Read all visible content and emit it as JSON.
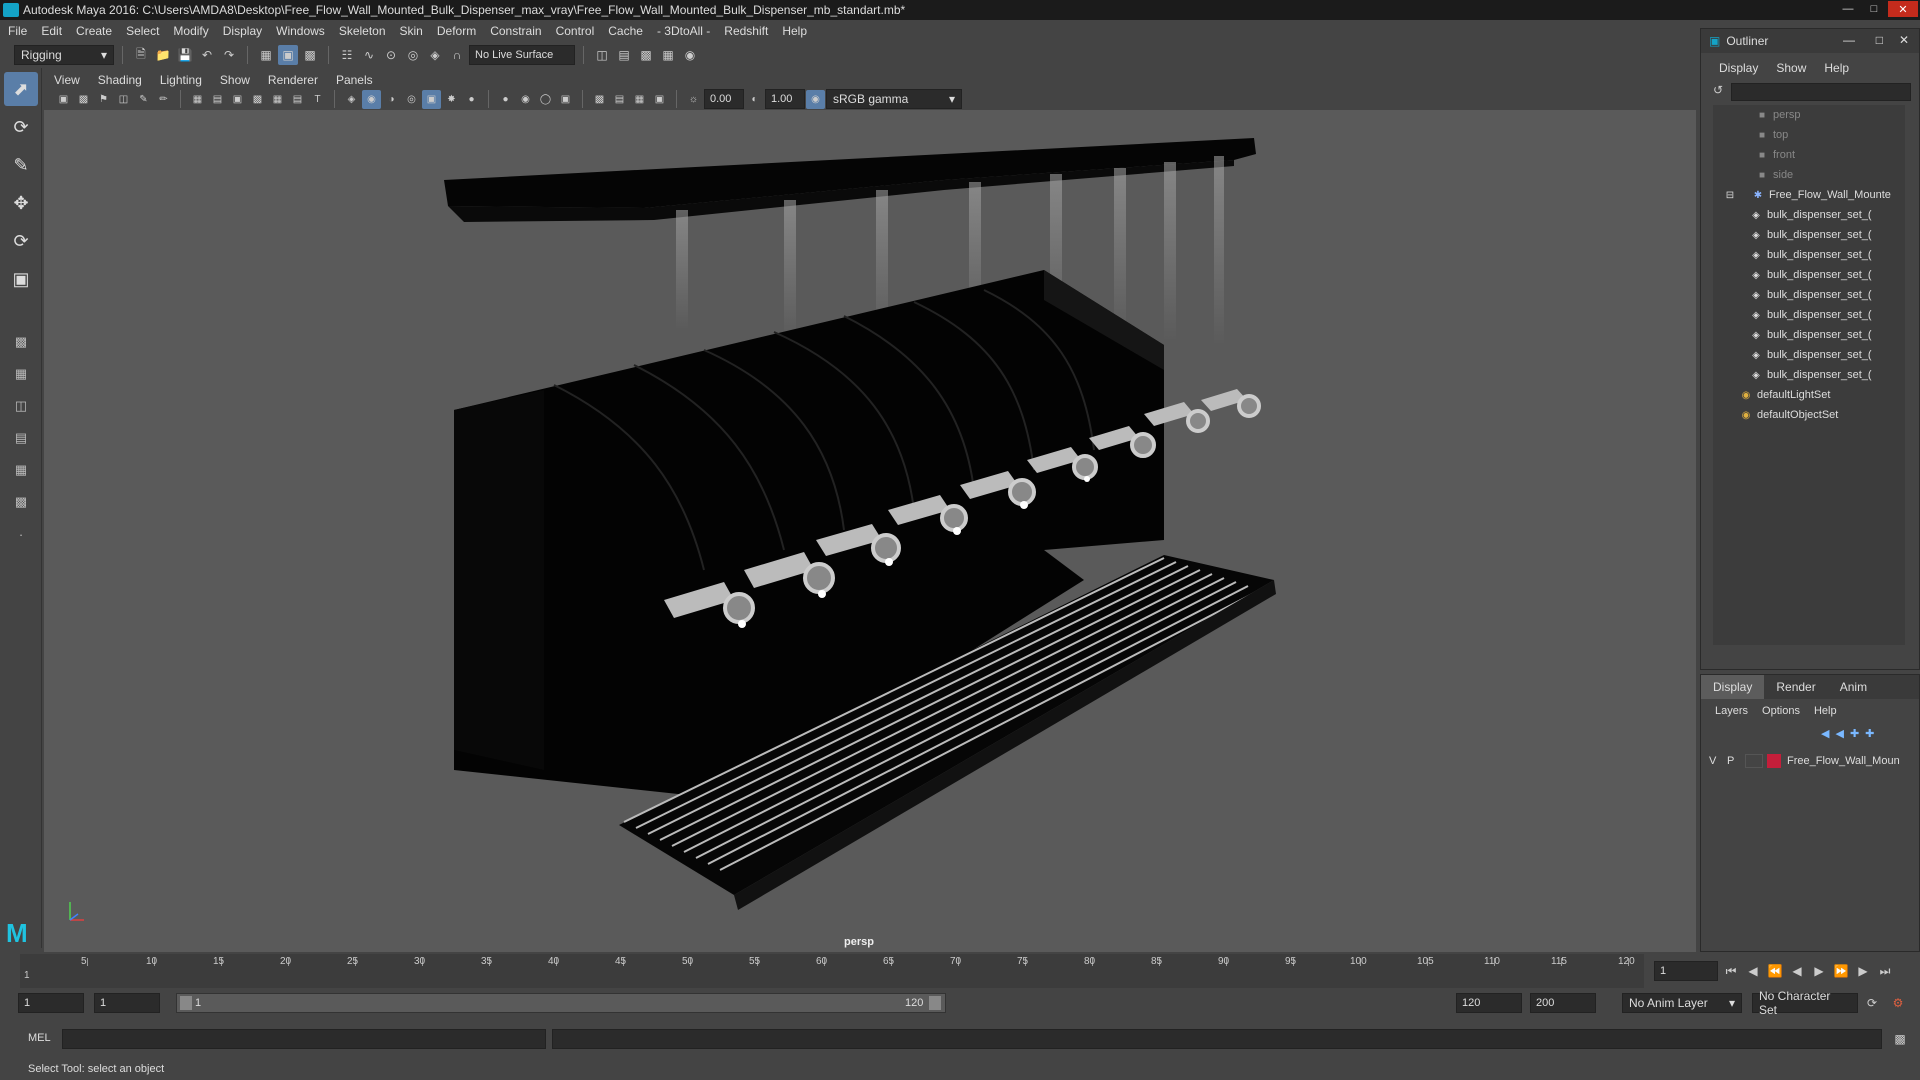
{
  "window": {
    "title": "Autodesk Maya 2016: C:\\Users\\AMDA8\\Desktop\\Free_Flow_Wall_Mounted_Bulk_Dispenser_max_vray\\Free_Flow_Wall_Mounted_Bulk_Dispenser_mb_standart.mb*"
  },
  "menubar": {
    "items": [
      "File",
      "Edit",
      "Create",
      "Select",
      "Modify",
      "Display",
      "Windows",
      "Skeleton",
      "Skin",
      "Deform",
      "Constrain",
      "Control",
      "Cache",
      "- 3DtoAll -",
      "Redshift",
      "Help"
    ]
  },
  "shelf": {
    "mode": "Rigging",
    "live_surface": "No Live Surface"
  },
  "viewport": {
    "menu": [
      "View",
      "Shading",
      "Lighting",
      "Show",
      "Renderer",
      "Panels"
    ],
    "exposure": "0.00",
    "gamma": "1.00",
    "color_space": "sRGB gamma",
    "camera": "persp"
  },
  "outliner": {
    "title": "Outliner",
    "menu": [
      "Display",
      "Show",
      "Help"
    ],
    "items": [
      {
        "label": "persp",
        "dim": true
      },
      {
        "label": "top",
        "dim": true
      },
      {
        "label": "front",
        "dim": true
      },
      {
        "label": "side",
        "dim": true
      },
      {
        "label": "Free_Flow_Wall_Mounte",
        "dim": false
      },
      {
        "label": "bulk_dispenser_set_(",
        "dim": false
      },
      {
        "label": "bulk_dispenser_set_(",
        "dim": false
      },
      {
        "label": "bulk_dispenser_set_(",
        "dim": false
      },
      {
        "label": "bulk_dispenser_set_(",
        "dim": false
      },
      {
        "label": "bulk_dispenser_set_(",
        "dim": false
      },
      {
        "label": "bulk_dispenser_set_(",
        "dim": false
      },
      {
        "label": "bulk_dispenser_set_(",
        "dim": false
      },
      {
        "label": "bulk_dispenser_set_(",
        "dim": false
      },
      {
        "label": "bulk_dispenser_set_(",
        "dim": false
      },
      {
        "label": "defaultLightSet",
        "dim": false
      },
      {
        "label": "defaultObjectSet",
        "dim": false
      }
    ]
  },
  "layers": {
    "tabs": [
      "Display",
      "Render",
      "Anim"
    ],
    "menu": [
      "Layers",
      "Options",
      "Help"
    ],
    "layer": {
      "v": "V",
      "p": "P",
      "name": "Free_Flow_Wall_Moun",
      "color": "#c41e3a"
    }
  },
  "timeline": {
    "ticks": [
      "5",
      "10",
      "15",
      "20",
      "25",
      "30",
      "35",
      "40",
      "45",
      "50",
      "55",
      "60",
      "65",
      "70",
      "75",
      "80",
      "85",
      "90",
      "95",
      "100",
      "105",
      "110",
      "115",
      "120"
    ],
    "start_marker": "1",
    "current_frame": "1"
  },
  "range": {
    "start": "1",
    "playback_start": "1",
    "slider_start": "1",
    "slider_end": "120",
    "playback_end": "120",
    "end": "200",
    "anim_layer": "No Anim Layer",
    "character_set": "No Character Set"
  },
  "command": {
    "lang": "MEL"
  },
  "helpline": {
    "text": "Select Tool: select an object"
  },
  "colors": {
    "accent": "#5a7ea8",
    "maya_blue": "#14a3c7"
  }
}
